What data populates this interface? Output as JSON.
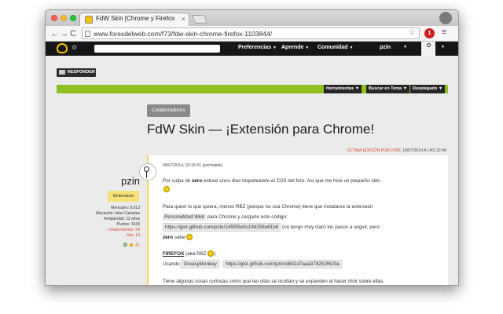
{
  "browser": {
    "tab_title": "FdW Skin [Chrome y Firefox",
    "tab_close": "×",
    "url": "www.foresdelweb.com/f73/fdw-skin-chrome-firefox-1103844/",
    "back_glyph": "←",
    "forward_glyph": "→",
    "reload_glyph": "C",
    "star_glyph": "☆",
    "menu_glyph": "≡",
    "ext_badge": "1"
  },
  "site_nav": {
    "items": [
      {
        "label": "Preferencias"
      },
      {
        "label": "Aprende"
      },
      {
        "label": "Comunidad"
      }
    ],
    "username": "pzin"
  },
  "thread_toolbar": {
    "reply_label": "RESPONDER",
    "tools": [
      {
        "label": "Herramientas"
      },
      {
        "label": "Buscar en Tema"
      },
      {
        "label": "Desplegado"
      }
    ]
  },
  "post": {
    "category": "Colaboradores",
    "title": "FdW Skin — ¡Extensión para Chrome!",
    "edit_label": "ÚLTIMA EDICIÓN POR PZIN;",
    "edit_date": " 10/07/2014 A LAS 22:46",
    "meta": "09/07/2014, 02:18  #1 (permalink)",
    "paragraphs": {
      "p1_a": "Por culpa de ",
      "p1_b": "zero",
      "p1_c": " estuve unos días toqueteando el CSS del foro. Así que me hice un pequeño skin.",
      "p2": "Para quien lo que quiera, menos RBZ (porque no usa Chrome) tiene que instalarse la extensión",
      "p3_code": "Personalized Web",
      "p3_text": " para Chrome y cargarle este código:",
      "p4_code": "https://gist.github.com/pzin/145f95e0c19d258a61b6",
      "p4_text": " (no tengo muy claro los pasos a seguir, pero",
      "p5_b": "zero",
      "p5_text": " sabe",
      "firefox_heading": "FIREFOX",
      "firefox_note": " (aka RBZ ",
      "firefox_note_end": ")",
      "usando": "Usando ",
      "greasy": "GreasyMonkey",
      "greasy_sep": " : ",
      "greasy_link": "https://gist.github.com/pzin/d831d7aaa378252f620a",
      "last": "Tiene algunas cosas curiosas como que las citas se ocultan y se expanden al hacer click sobre ellas."
    }
  },
  "author": {
    "name": "pzin",
    "role": "Moderatorin",
    "stats": [
      {
        "label": "Mensajes: 9.013"
      },
      {
        "label": "Ubicación: Islas Canarias"
      },
      {
        "label": "Antigüedad: 12 años"
      },
      {
        "label": "Puntos: 1543"
      }
    ],
    "colaboradores": "- colaboradores: 54",
    "fdw": "- fdw: 13"
  },
  "colors": {
    "header_bg": "#161616",
    "green_bar": "#8fbf21",
    "accent_red": "#d84a2f",
    "role_badge": "#f7e27a"
  }
}
